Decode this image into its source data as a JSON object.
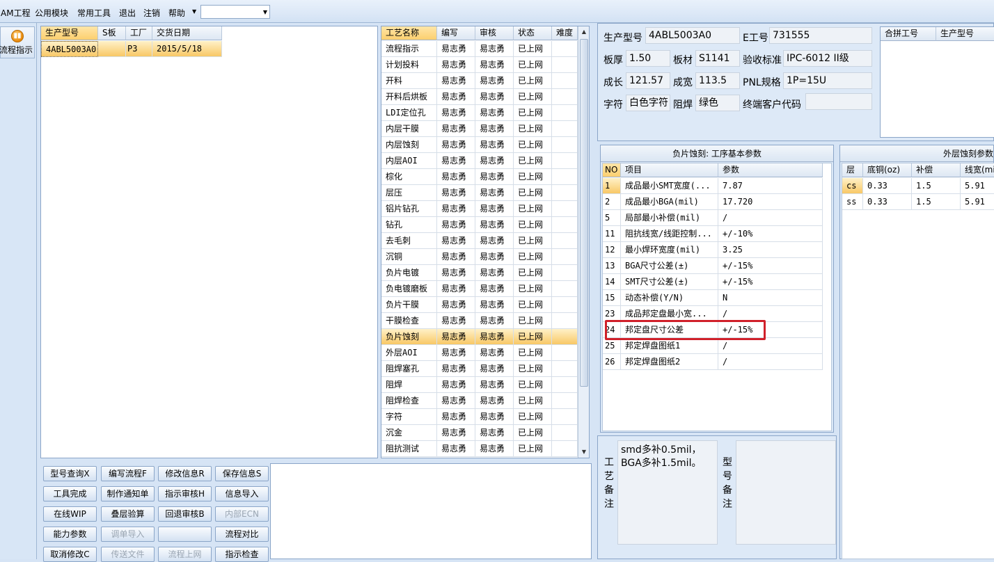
{
  "menu": {
    "items": [
      "AM工程",
      "公用模块",
      "常用工具",
      "退出",
      "注销",
      "帮助"
    ],
    "dropdown_value": ""
  },
  "nav": {
    "button_label": "流程指示"
  },
  "orders": {
    "columns": [
      "生产型号",
      "S板",
      "工厂",
      "交货日期"
    ],
    "rows": [
      [
        "4ABL5003A0",
        "",
        "P3",
        "2015/5/18"
      ]
    ]
  },
  "process": {
    "columns": [
      "工艺名称",
      "编写",
      "审核",
      "状态",
      "难度"
    ],
    "rows": [
      [
        "流程指示",
        "易志勇",
        "易志勇",
        "已上网",
        ""
      ],
      [
        "计划投料",
        "易志勇",
        "易志勇",
        "已上网",
        ""
      ],
      [
        "开料",
        "易志勇",
        "易志勇",
        "已上网",
        ""
      ],
      [
        "开料后烘板",
        "易志勇",
        "易志勇",
        "已上网",
        ""
      ],
      [
        "LDI定位孔",
        "易志勇",
        "易志勇",
        "已上网",
        ""
      ],
      [
        "内层干膜",
        "易志勇",
        "易志勇",
        "已上网",
        ""
      ],
      [
        "内层蚀刻",
        "易志勇",
        "易志勇",
        "已上网",
        ""
      ],
      [
        "内层AOI",
        "易志勇",
        "易志勇",
        "已上网",
        ""
      ],
      [
        "棕化",
        "易志勇",
        "易志勇",
        "已上网",
        ""
      ],
      [
        "层压",
        "易志勇",
        "易志勇",
        "已上网",
        ""
      ],
      [
        "铝片钻孔",
        "易志勇",
        "易志勇",
        "已上网",
        ""
      ],
      [
        "钻孔",
        "易志勇",
        "易志勇",
        "已上网",
        ""
      ],
      [
        "去毛刺",
        "易志勇",
        "易志勇",
        "已上网",
        ""
      ],
      [
        "沉铜",
        "易志勇",
        "易志勇",
        "已上网",
        ""
      ],
      [
        "负片电镀",
        "易志勇",
        "易志勇",
        "已上网",
        ""
      ],
      [
        "负电镀磨板",
        "易志勇",
        "易志勇",
        "已上网",
        ""
      ],
      [
        "负片干膜",
        "易志勇",
        "易志勇",
        "已上网",
        ""
      ],
      [
        "干膜检查",
        "易志勇",
        "易志勇",
        "已上网",
        ""
      ],
      [
        "负片蚀刻",
        "易志勇",
        "易志勇",
        "已上网",
        ""
      ],
      [
        "外层AOI",
        "易志勇",
        "易志勇",
        "已上网",
        ""
      ],
      [
        "阻焊塞孔",
        "易志勇",
        "易志勇",
        "已上网",
        ""
      ],
      [
        "阻焊",
        "易志勇",
        "易志勇",
        "已上网",
        ""
      ],
      [
        "阻焊检查",
        "易志勇",
        "易志勇",
        "已上网",
        ""
      ],
      [
        "字符",
        "易志勇",
        "易志勇",
        "已上网",
        ""
      ],
      [
        "沉金",
        "易志勇",
        "易志勇",
        "已上网",
        ""
      ],
      [
        "阻抗测试",
        "易志勇",
        "易志勇",
        "已上网",
        ""
      ]
    ],
    "selected_row": 18
  },
  "buttons": [
    [
      "型号查询X",
      "编写流程F",
      "修改信息R",
      "保存信息S"
    ],
    [
      "工具完成",
      "制作通知单",
      "指示审核H",
      "信息导入"
    ],
    [
      "在线WIP",
      "叠层验算",
      "回退审核B",
      "内部ECN"
    ],
    [
      "能力参数",
      "调单导入",
      "",
      "流程对比"
    ],
    [
      "取消修改C",
      "传送文件",
      "流程上网",
      "指示检查"
    ]
  ],
  "buttons_disabled": [
    [
      false,
      false,
      false,
      false
    ],
    [
      false,
      false,
      false,
      false
    ],
    [
      false,
      false,
      false,
      true
    ],
    [
      false,
      true,
      false,
      false
    ],
    [
      false,
      true,
      true,
      false
    ]
  ],
  "info": {
    "labels": [
      "生产型号",
      "E工号",
      "板厚",
      "板材",
      "验收标准",
      "成长",
      "成宽",
      "PNL规格",
      "字符",
      "阻焊",
      "终端客户代码"
    ],
    "values": [
      "4ABL5003A0",
      "731555",
      "1.50",
      "S1141",
      "IPC-6012 II级",
      "121.57",
      "113.5",
      "1P=15U",
      "白色字符",
      "绿色",
      ""
    ]
  },
  "merge": {
    "columns": [
      "合拼工号",
      "生产型号"
    ]
  },
  "params": {
    "title": "负片蚀刻: 工序基本参数",
    "columns": [
      "NO",
      "项目",
      "参数"
    ],
    "rows": [
      [
        "1",
        "成品最小SMT宽度(...",
        "7.87"
      ],
      [
        "2",
        "成品最小BGA(mil)",
        "17.720"
      ],
      [
        "5",
        "局部最小补偿(mil)",
        "/"
      ],
      [
        "11",
        "阻抗线宽/线距控制...",
        "+/-10%"
      ],
      [
        "12",
        "最小焊环宽度(mil)",
        "3.25"
      ],
      [
        "13",
        "BGA尺寸公差(±)",
        "+/-15%"
      ],
      [
        "14",
        "SMT尺寸公差(±)",
        "+/-15%"
      ],
      [
        "15",
        "动态补偿(Y/N)",
        "N"
      ],
      [
        "23",
        "成品邦定盘最小宽...",
        "/"
      ],
      [
        "24",
        "邦定盘尺寸公差",
        "+/-15%"
      ],
      [
        "25",
        "邦定焊盘图纸1",
        "/"
      ],
      [
        "26",
        "邦定焊盘图纸2",
        "/"
      ]
    ]
  },
  "outer": {
    "title": "外层蚀刻参数",
    "columns": [
      "层",
      "底铜(oz)",
      "补偿",
      "线宽(mi"
    ],
    "rows": [
      [
        "cs",
        "0.33",
        "1.5",
        "5.91"
      ],
      [
        "ss",
        "0.33",
        "1.5",
        "5.91"
      ]
    ]
  },
  "notes": {
    "process_label": "工艺备注",
    "process_text": "smd多补0.5mil，BGA多补1.5mil。",
    "model_label": "型号备注"
  }
}
